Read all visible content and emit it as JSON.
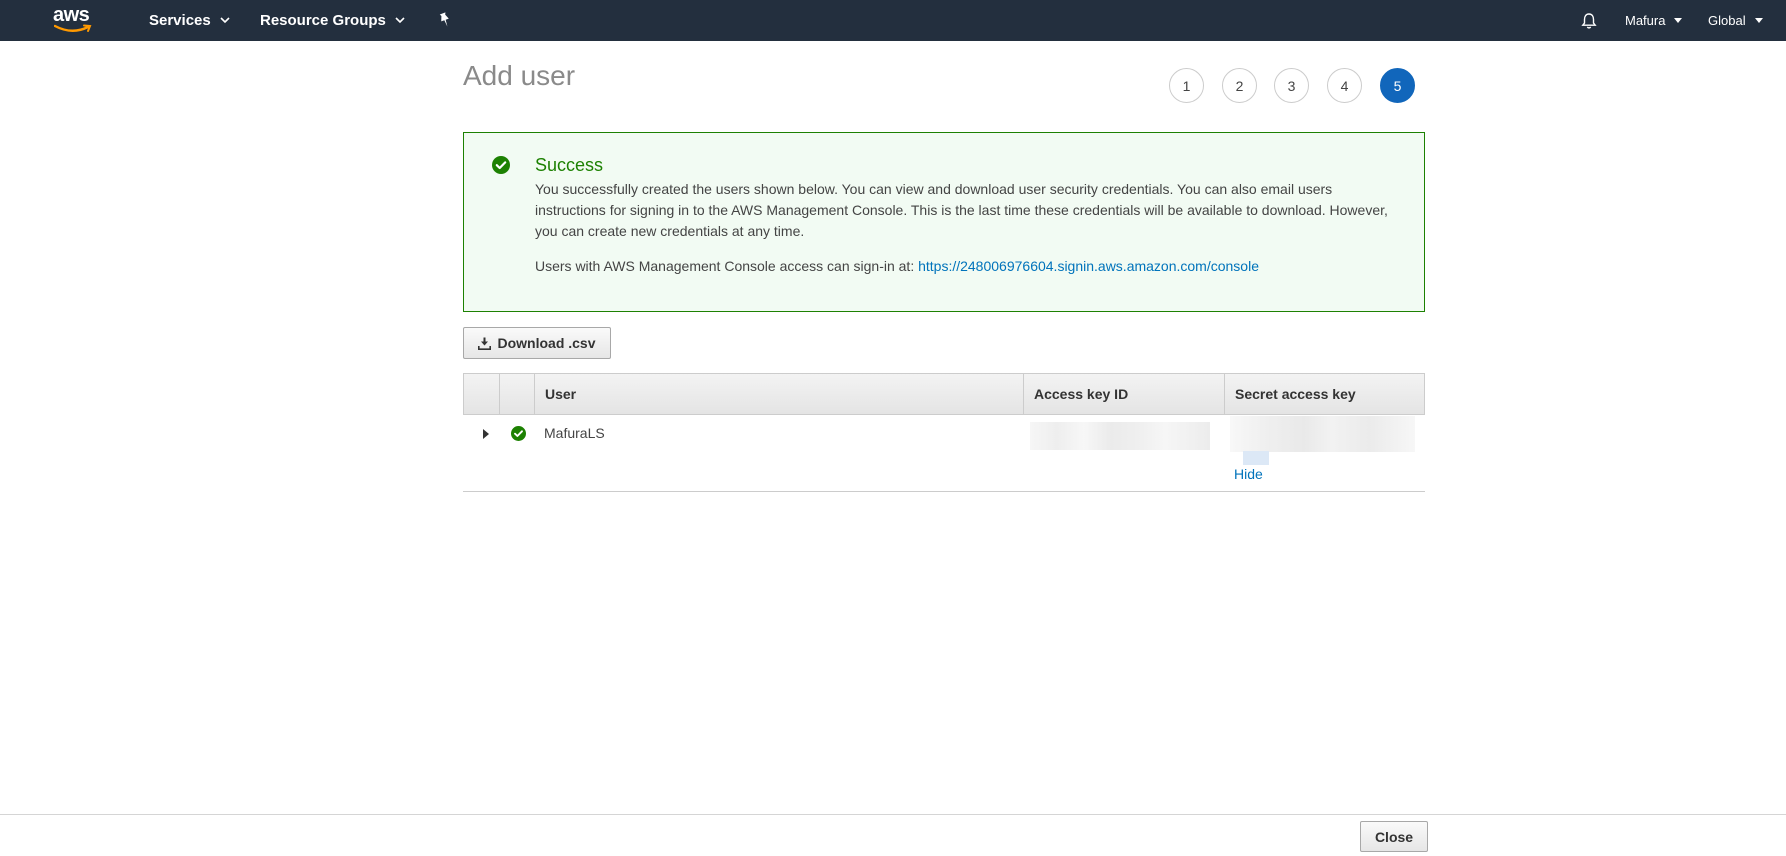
{
  "nav": {
    "logo": "aws",
    "services": "Services",
    "resource_groups": "Resource Groups",
    "user": "Mafura",
    "region": "Global"
  },
  "page": {
    "title": "Add user",
    "steps": [
      "1",
      "2",
      "3",
      "4",
      "5"
    ],
    "active_step": "5"
  },
  "success": {
    "title": "Success",
    "message": "You successfully created the users shown below. You can view and download user security credentials. You can also email users instructions for signing in to the AWS Management Console. This is the last time these credentials will be available to download. However, you can create new credentials at any time.",
    "signin_prefix": "Users with AWS Management Console access can sign-in at: ",
    "signin_url": "https://248006976604.signin.aws.amazon.com/console"
  },
  "download_label": "Download .csv",
  "table": {
    "columns": [
      "User",
      "Access key ID",
      "Secret access key"
    ],
    "rows": [
      {
        "user": "MafuraLS",
        "secret_action": "Hide"
      }
    ]
  },
  "footer": {
    "close_label": "Close"
  },
  "colors": {
    "nav_bg": "#232f3e",
    "success_green": "#1d8102",
    "active_step_blue": "#1166bb",
    "link_blue": "#0073bb"
  }
}
